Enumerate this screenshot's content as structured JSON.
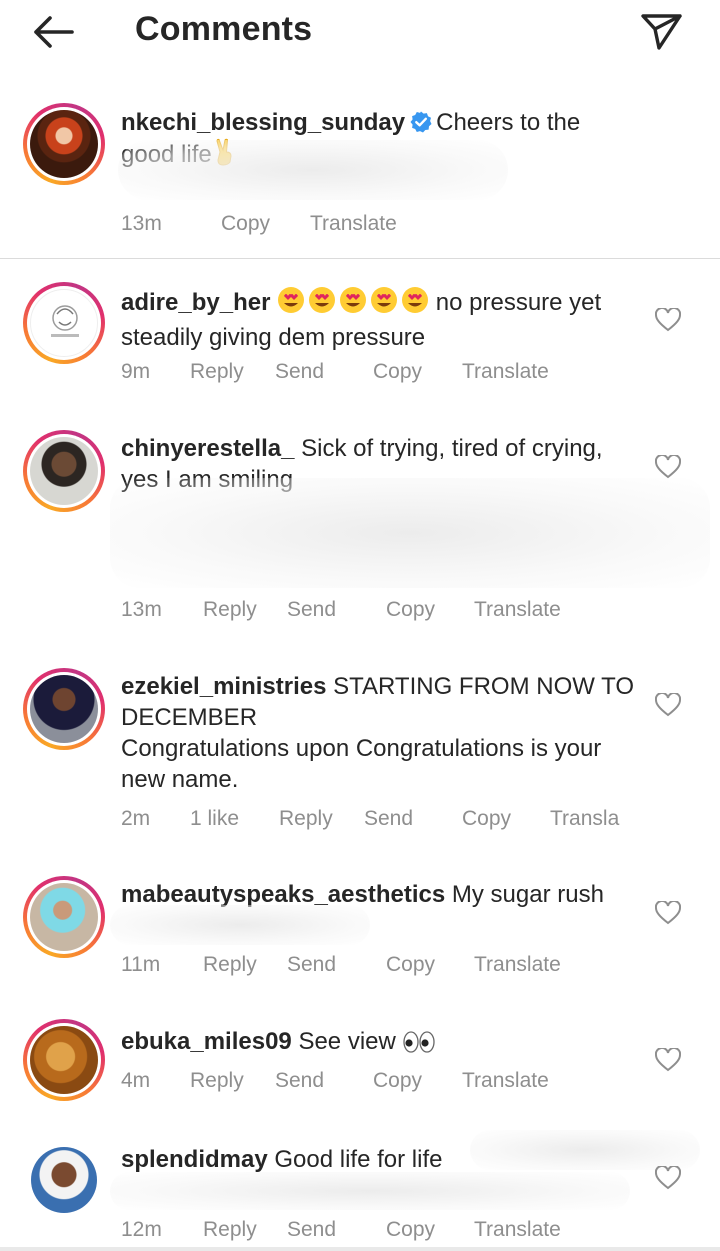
{
  "header": {
    "title": "Comments"
  },
  "caption": {
    "username": "nkechi_blessing_sunday",
    "text": "Cheers to the good life",
    "time": "13m",
    "copy": "Copy",
    "translate": "Translate"
  },
  "comments": [
    {
      "username": "adire_by_her",
      "text": "no pressure yet steadily giving dem pressure",
      "time": "9m",
      "reply": "Reply",
      "send": "Send",
      "copy": "Copy",
      "translate": "Translate"
    },
    {
      "username": "chinyerestella_",
      "text": "Sick of trying, tired of crying, yes I am smiling",
      "time": "13m",
      "reply": "Reply",
      "send": "Send",
      "copy": "Copy",
      "translate": "Translate"
    },
    {
      "username": "ezekiel_ministries",
      "text": "STARTING FROM NOW TO DECEMBER",
      "text2": "Congratulations upon Congratulations is your new name.",
      "time": "2m",
      "likes": "1 like",
      "reply": "Reply",
      "send": "Send",
      "copy": "Copy",
      "translate": "Transla"
    },
    {
      "username": "mabeautyspeaks_aesthetics",
      "text": "My sugar rush",
      "time": "11m",
      "reply": "Reply",
      "send": "Send",
      "copy": "Copy",
      "translate": "Translate"
    },
    {
      "username": "ebuka_miles09",
      "text": "See view",
      "time": "4m",
      "reply": "Reply",
      "send": "Send",
      "copy": "Copy",
      "translate": "Translate"
    },
    {
      "username": "splendidmay",
      "text": "Good life for life",
      "time": "12m",
      "reply": "Reply",
      "send": "Send",
      "copy": "Copy",
      "translate": "Translate"
    }
  ],
  "icons": {
    "back": "back-arrow-icon",
    "share": "paper-plane-icon",
    "verified": "verified-badge-icon",
    "like": "heart-outline-icon",
    "victory": "victory-hand-emoji",
    "heart_eyes": "heart-eyes-emoji",
    "eyes": "eyes-emoji"
  },
  "colors": {
    "text": "#262626",
    "meta": "#8e8e8e",
    "verified": "#3897f0",
    "divider": "#dbdbdb"
  }
}
